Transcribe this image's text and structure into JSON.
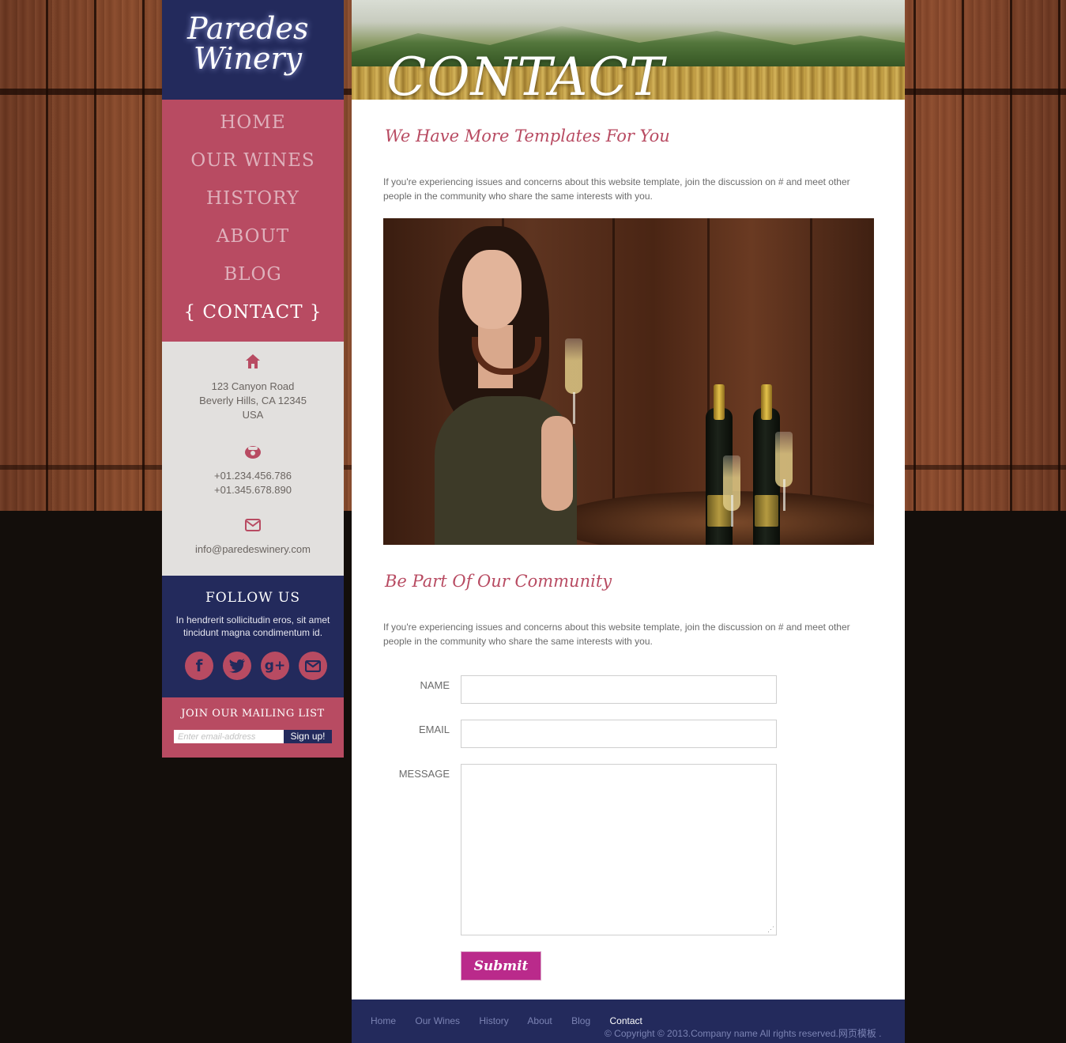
{
  "brand": {
    "line1": "Paredes",
    "line2": "Winery"
  },
  "nav": {
    "items": [
      {
        "label": "HOME",
        "active": false
      },
      {
        "label": "OUR WINES",
        "active": false
      },
      {
        "label": "HISTORY",
        "active": false
      },
      {
        "label": "ABOUT",
        "active": false
      },
      {
        "label": "BLOG",
        "active": false
      },
      {
        "label": "{ CONTACT }",
        "active": true
      }
    ]
  },
  "contact": {
    "address": [
      "123 Canyon Road",
      "Beverly Hills, CA 12345",
      "USA"
    ],
    "phones": [
      "+01.234.456.786",
      "+01.345.678.890"
    ],
    "email": "info@paredeswinery.com",
    "icons": {
      "home": "home-icon",
      "phone": "phone-icon",
      "mail": "mail-icon"
    }
  },
  "follow": {
    "title": "FOLLOW US",
    "text": "In hendrerit sollicitudin eros, sit amet tincidunt magna condimentum id.",
    "socials": [
      "facebook-icon",
      "twitter-icon",
      "google-plus-icon",
      "email-icon"
    ]
  },
  "mailing": {
    "title": "JOIN OUR MAILING LIST",
    "placeholder": "Enter email-address",
    "button": "Sign up!"
  },
  "hero": {
    "title": "CONTACT"
  },
  "section1": {
    "heading": "We Have More Templates For You",
    "text": "If you're experiencing issues and concerns about this website template, join the discussion on # and meet other people in the community who share the same interests with you."
  },
  "section2": {
    "heading": "Be Part Of Our Community",
    "text": "If you're experiencing issues and concerns about this website template, join the discussion on # and meet other people in the community who share the same interests with you."
  },
  "form": {
    "name_label": "NAME",
    "name_value": "",
    "email_label": "EMAIL",
    "email_value": "",
    "message_label": "MESSAGE",
    "message_value": "",
    "submit": "Submit"
  },
  "footer": {
    "links": [
      {
        "label": "Home",
        "active": false
      },
      {
        "label": "Our Wines",
        "active": false
      },
      {
        "label": "History",
        "active": false
      },
      {
        "label": "About",
        "active": false
      },
      {
        "label": "Blog",
        "active": false
      },
      {
        "label": "Contact",
        "active": true
      }
    ],
    "copyright": "© Copyright © 2013.Company name All rights reserved.网页模板 ."
  },
  "colors": {
    "navy": "#232a5c",
    "rose": "#b84b62",
    "magenta": "#ba2a8b"
  }
}
